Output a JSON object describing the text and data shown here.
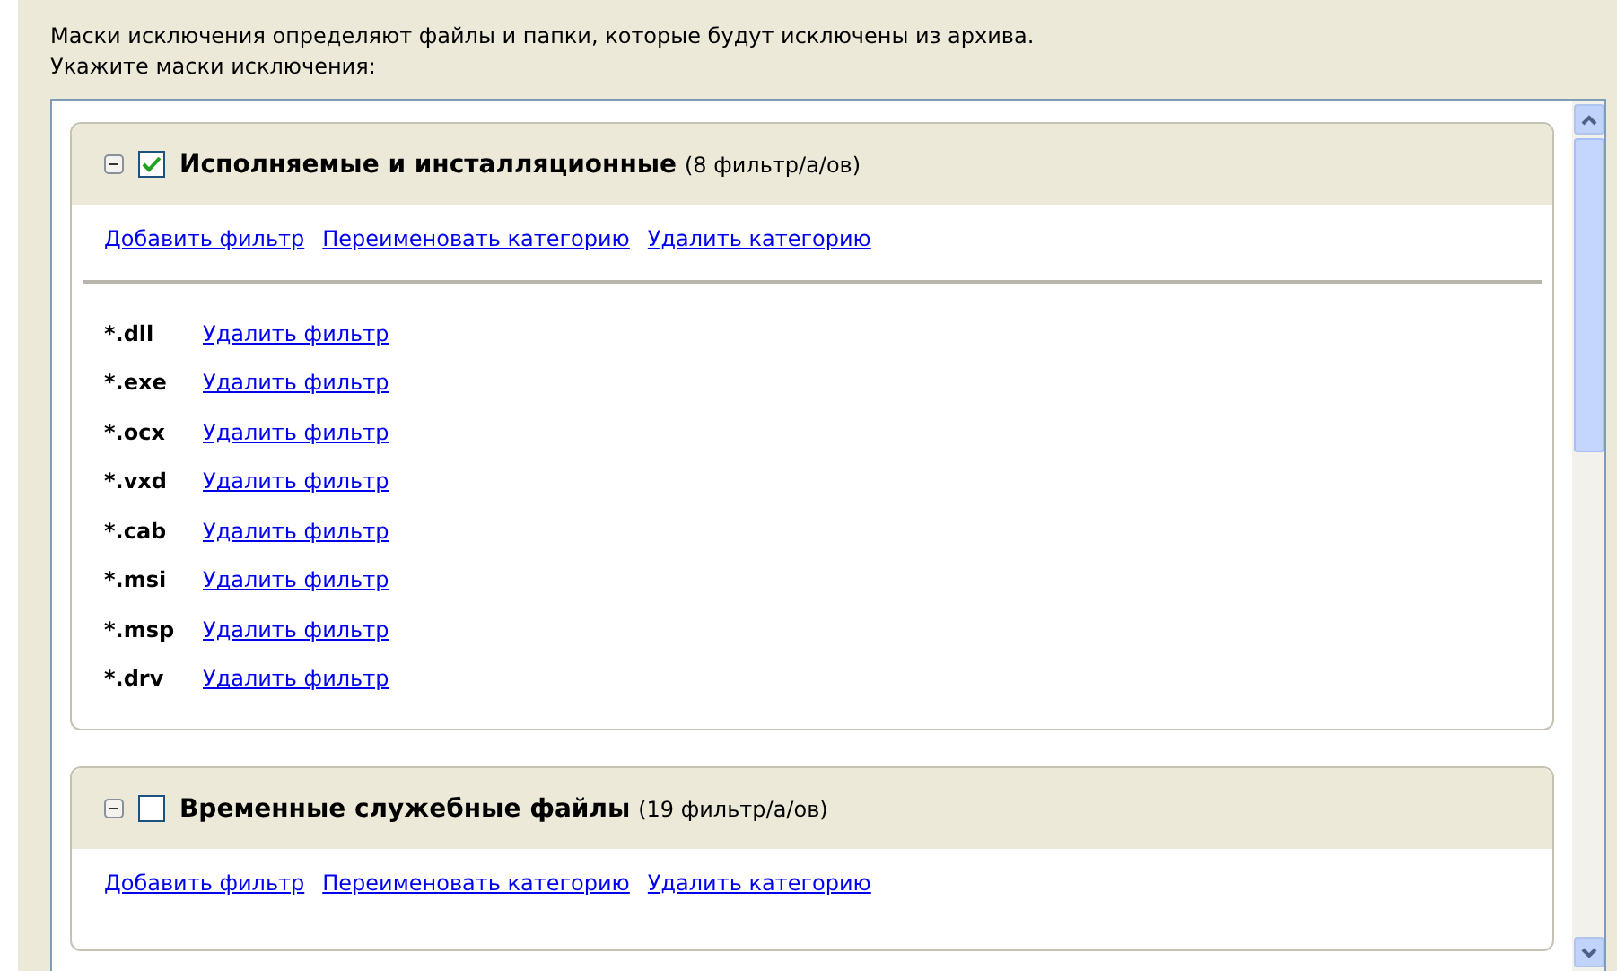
{
  "intro": [
    "Маски исключения определяют файлы и папки, которые будут исключены из архива.",
    "Укажите маски исключения:"
  ],
  "categories": [
    {
      "name": "Исполняемые и инсталляционные",
      "count": "(8 фильтр/а/ов)",
      "checked": true,
      "expanded": true,
      "actions": [
        "Добавить фильтр",
        "Переименовать категорию",
        "Удалить категорию"
      ],
      "filters": [
        {
          "mask": "*.dll",
          "action": "Удалить фильтр"
        },
        {
          "mask": "*.exe",
          "action": "Удалить фильтр"
        },
        {
          "mask": "*.ocx",
          "action": "Удалить фильтр"
        },
        {
          "mask": "*.vxd",
          "action": "Удалить фильтр"
        },
        {
          "mask": "*.cab",
          "action": "Удалить фильтр"
        },
        {
          "mask": "*.msi",
          "action": "Удалить фильтр"
        },
        {
          "mask": "*.msp",
          "action": "Удалить фильтр"
        },
        {
          "mask": "*.drv",
          "action": "Удалить фильтр"
        }
      ]
    },
    {
      "name": "Временные служебные файлы",
      "count": "(19 фильтр/а/ов)",
      "checked": false,
      "expanded": true,
      "actions": [
        "Добавить фильтр",
        "Переименовать категорию",
        "Удалить категорию"
      ]
    }
  ]
}
